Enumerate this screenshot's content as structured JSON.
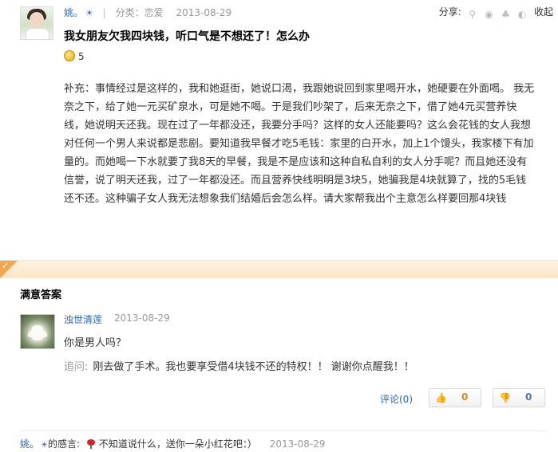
{
  "question": {
    "user": "姚。",
    "user_badge": "☀",
    "category_label": "分类：",
    "category": "恋爱",
    "date": "2013-08-29",
    "title": "我女朋友欠我四块钱，听口气是不想还了！怎么办",
    "reward": "5",
    "supplement": "补充：事情经过是这样的，我和她逛街，她说口渴，我跟她说回到家里喝开水，她硬要在外面喝。 我无奈之下，给了她一元买矿泉水，可是她不喝。于是我们吵架了，后来无奈之下，借了她4元买营养快线，她说明天还我。现在过了一年都没还，我要分手吗？这样的女人还能要吗？这么会花钱的女人我想对任何一个男人来说都是悲剧。要知道我早餐才吃5毛钱：家里的白开水，加上1个馒头，我家楼下有加量的。而她喝一下水就要了我8天的早餐，我是不是应该和这种自私自利的女人分手呢？而且她还没有信誉，说了明天还我，过了一年都没还。而且营养快线明明是3块5，她骗我是4块就算了，找的5毛钱还不还。这种骗子女人我无法想象我们结婚后会怎么样。请大家帮我出个主意怎么样要回那4块钱"
  },
  "share": {
    "label": "分享:",
    "collapse": "收起",
    "icons": [
      "search-icon",
      "weibo-icon",
      "qq-icon",
      "tencent-weibo-icon"
    ]
  },
  "best_answer": {
    "section_title": "满意答案",
    "user": "浊世清莲",
    "date": "2013-08-29",
    "text": "你是男人吗？",
    "follow_label": "追问:",
    "follow_text": "刚去做了手术。我也要享受借4块钱不还的特权！！ 谢谢你点醒我！！",
    "comment": "评论(0)",
    "upvotes": "0",
    "downvotes": "0"
  },
  "thanks": {
    "user": "姚。",
    "badge": "☀",
    "label": "的感言:",
    "text": "不知道说什么，送你一朵小红花吧：）",
    "date": "2013-08-29"
  },
  "colors": {
    "link": "#2d64b3",
    "accent": "#f1a84f",
    "best_header_bg": "#fbe6c7"
  }
}
